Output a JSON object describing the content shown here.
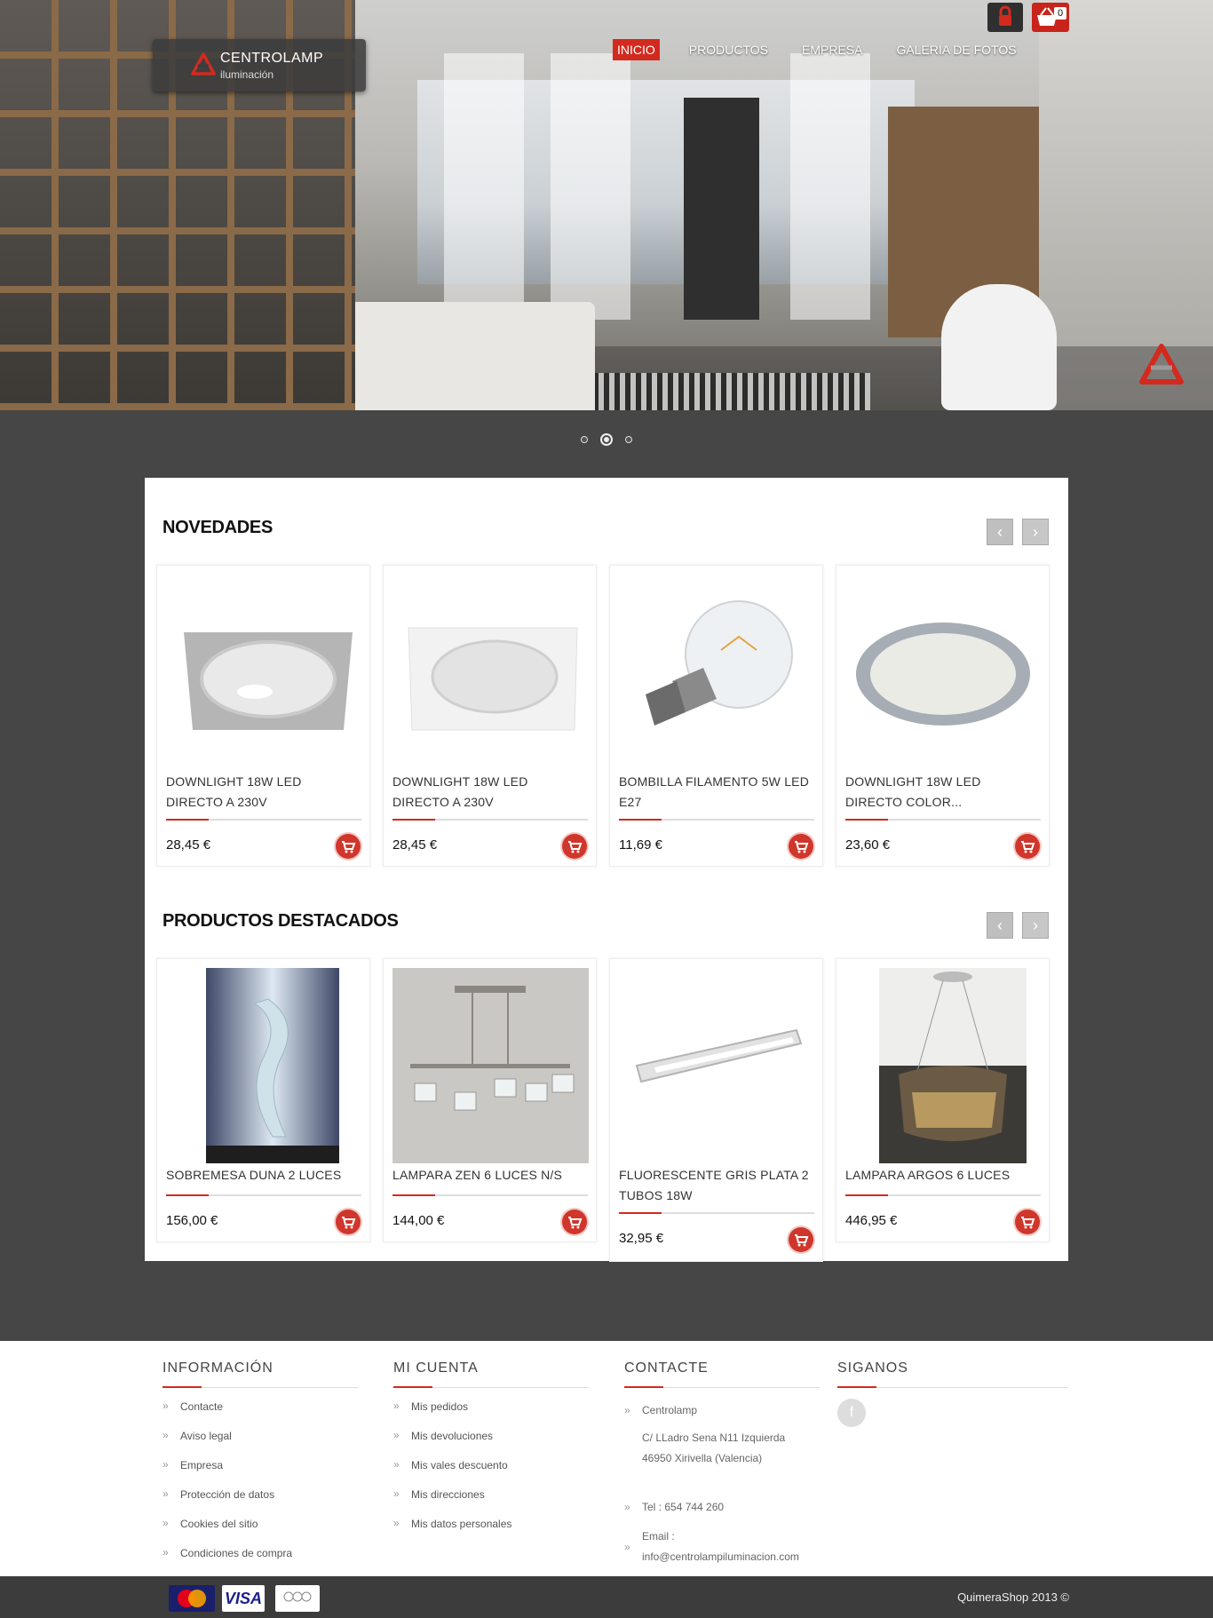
{
  "header": {
    "logo_name": "CENTROLAMP",
    "logo_sub": "iluminación",
    "nav": [
      "INICIO",
      "PRODUCTOS",
      "EMPRESA",
      "GALERIA DE FOTOS"
    ],
    "cart_count": "0"
  },
  "slider": {
    "dots": 3,
    "active": 2
  },
  "novedades": {
    "title": "NOVEDADES",
    "products": [
      {
        "name": "DOWNLIGHT 18W LED DIRECTO A 230V",
        "price": "28,45 €"
      },
      {
        "name": "DOWNLIGHT 18W LED DIRECTO A 230V",
        "price": "28,45 €"
      },
      {
        "name": "BOMBILLA FILAMENTO 5W LED E27",
        "price": "11,69 €"
      },
      {
        "name": "DOWNLIGHT 18W LED DIRECTO COLOR...",
        "price": "23,60 €"
      }
    ]
  },
  "destacados": {
    "title": "PRODUCTOS DESTACADOS",
    "products": [
      {
        "name": "SOBREMESA DUNA 2 LUCES",
        "price": "156,00 €"
      },
      {
        "name": "LAMPARA ZEN 6 LUCES N/S",
        "price": "144,00 €"
      },
      {
        "name": "FLUORESCENTE GRIS PLATA 2 TUBOS 18W",
        "price": "32,95 €"
      },
      {
        "name": "LAMPARA ARGOS 6 LUCES",
        "price": "446,95 €"
      }
    ]
  },
  "footer": {
    "info": {
      "title": "INFORMACIÓN",
      "items": [
        "Contacte",
        "Aviso legal",
        "Empresa",
        "Protección de datos",
        "Cookies del sitio",
        "Condiciones de compra"
      ]
    },
    "account": {
      "title": "MI CUENTA",
      "items": [
        "Mis pedidos",
        "Mis devoluciones",
        "Mis vales descuento",
        "Mis direcciones",
        "Mis datos personales"
      ]
    },
    "contact": {
      "title": "CONTACTE",
      "company": "Centrolamp",
      "address1": "C/ LLadro Sena N11 Izquierda",
      "address2": "46950 Xirivella (Valencia)",
      "tel": "Tel : 654 744 260",
      "email_label": "Email :",
      "email": "info@centrolampiluminacion.com"
    },
    "social": {
      "title": "SIGANOS",
      "facebook": "f"
    }
  },
  "bottom": {
    "payments": [
      "MasterCard",
      "VISA",
      "moneybookers"
    ],
    "copyright": "QuimeraShop 2013 ©"
  },
  "colors": {
    "accent": "#d32a1f",
    "background": "#464646",
    "panel": "#ffffff"
  }
}
